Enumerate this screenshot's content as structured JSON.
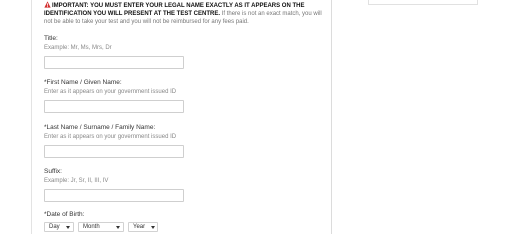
{
  "warning": {
    "icon": "warning-icon",
    "bold_text": "IMPORTANT: YOU MUST ENTER YOUR LEGAL NAME EXACTLY AS IT APPEARS ON THE IDENTIFICATION YOU WILL PRESENT AT THE TEST CENTRE.",
    "normal_text": "If there is not an exact match, you will not be able to take your test and you will not be reimbursed for any fees paid."
  },
  "fields": {
    "title": {
      "label": "Title:",
      "hint": "Example: Mr, Ms, Mrs, Dr",
      "value": ""
    },
    "first_name": {
      "label": "*First Name / Given Name:",
      "hint": "Enter as it appears on your government issued ID",
      "value": ""
    },
    "last_name": {
      "label": "*Last Name / Surname / Family Name:",
      "hint": "Enter as it appears on your government issued ID",
      "value": ""
    },
    "suffix": {
      "label": "Suffix:",
      "hint": "Example: Jr, Sr, II, III, IV",
      "value": ""
    },
    "date_of_birth": {
      "label": "*Date of Birth:",
      "day": "Day",
      "month": "Month",
      "year": "Year"
    }
  },
  "colors": {
    "warning_icon": "#d32f2f",
    "border": "#cfcfcf"
  }
}
